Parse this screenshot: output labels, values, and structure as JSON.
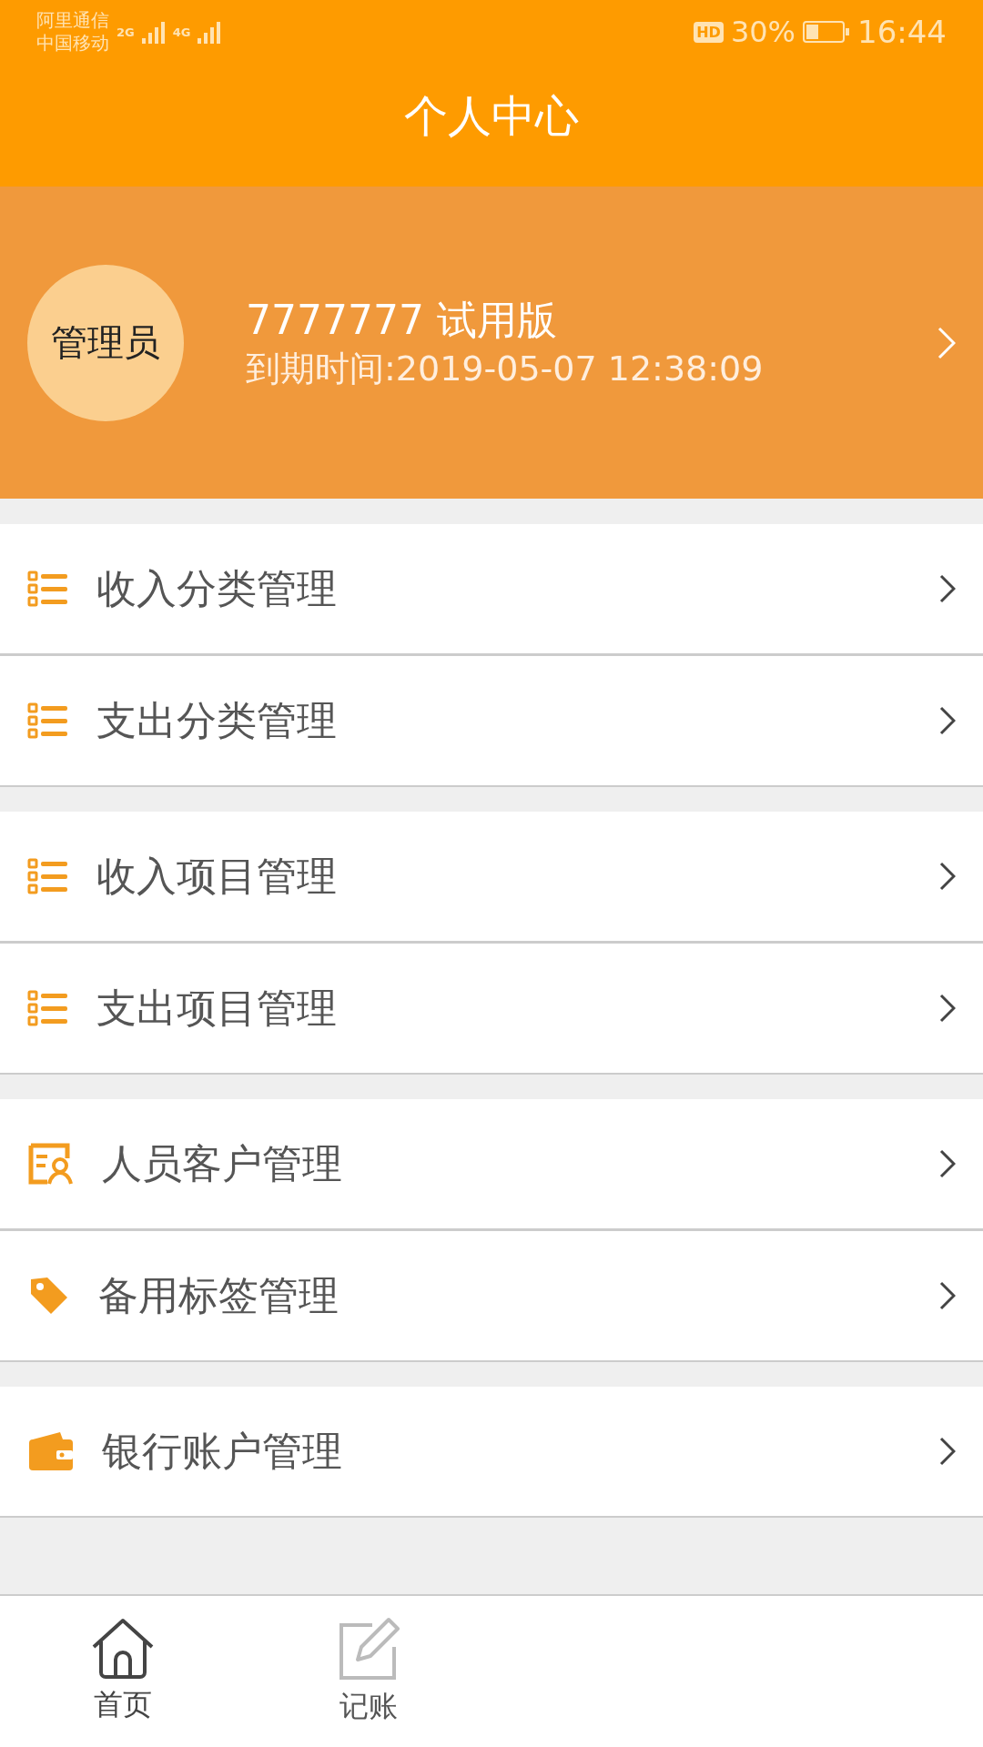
{
  "status_bar": {
    "carrier_1": "阿里通信",
    "carrier_2": "中国移动",
    "net_1": "2G",
    "net_2": "4G",
    "hd": "HD",
    "battery": "30%",
    "time": "16:44"
  },
  "header": {
    "title": "个人中心"
  },
  "profile": {
    "avatar": "管理员",
    "name": "7777777 试用版",
    "expiry": "到期时间:2019-05-07 12:38:09"
  },
  "groups": [
    {
      "items": [
        {
          "kind": "list",
          "label": "收入分类管理"
        },
        {
          "kind": "list",
          "label": "支出分类管理"
        }
      ]
    },
    {
      "items": [
        {
          "kind": "list",
          "label": "收入项目管理"
        },
        {
          "kind": "list",
          "label": "支出项目管理"
        }
      ]
    },
    {
      "items": [
        {
          "kind": "people",
          "label": "人员客户管理"
        },
        {
          "kind": "tag",
          "label": "备用标签管理"
        }
      ]
    },
    {
      "items": [
        {
          "kind": "wallet",
          "label": "银行账户管理"
        }
      ]
    }
  ],
  "tab_bar": [
    {
      "kind": "home",
      "label": "首页",
      "selected": true
    },
    {
      "kind": "edit",
      "label": "记账",
      "selected": false
    }
  ]
}
